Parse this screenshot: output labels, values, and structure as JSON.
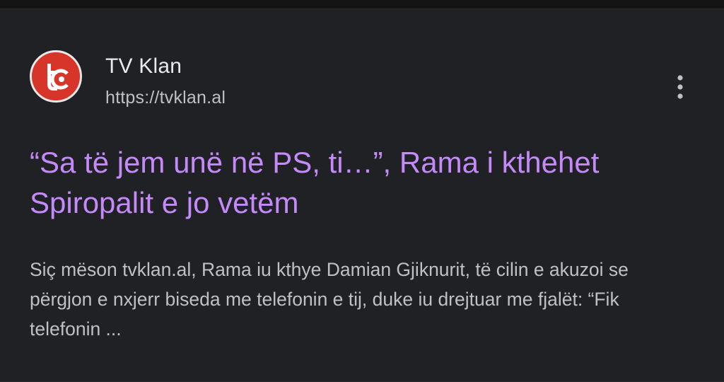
{
  "result": {
    "site_name": "TV Klan",
    "site_url": "https://tvklan.al",
    "favicon": "tvklan-logo-icon",
    "menu_icon": "more-vertical-icon",
    "headline": "“Sa të jem unë në PS, ti…”, Rama i kthehet Spiropalit e jo vetëm",
    "snippet": "Siç mëson tvklan.al, Rama iu kthye Damian Gjiknurit, të cilin e akuzoi se përgjon e nxjerr biseda me telefonin e tij, duke iu drejtuar me fjalët: “Fik telefonin ..."
  },
  "colors": {
    "page_background": "#141414",
    "card_background": "#202124",
    "headline": "#c58af9",
    "site_name": "#e8eaed",
    "secondary_text": "#bdc1c6",
    "favicon_red": "#d8352a"
  }
}
